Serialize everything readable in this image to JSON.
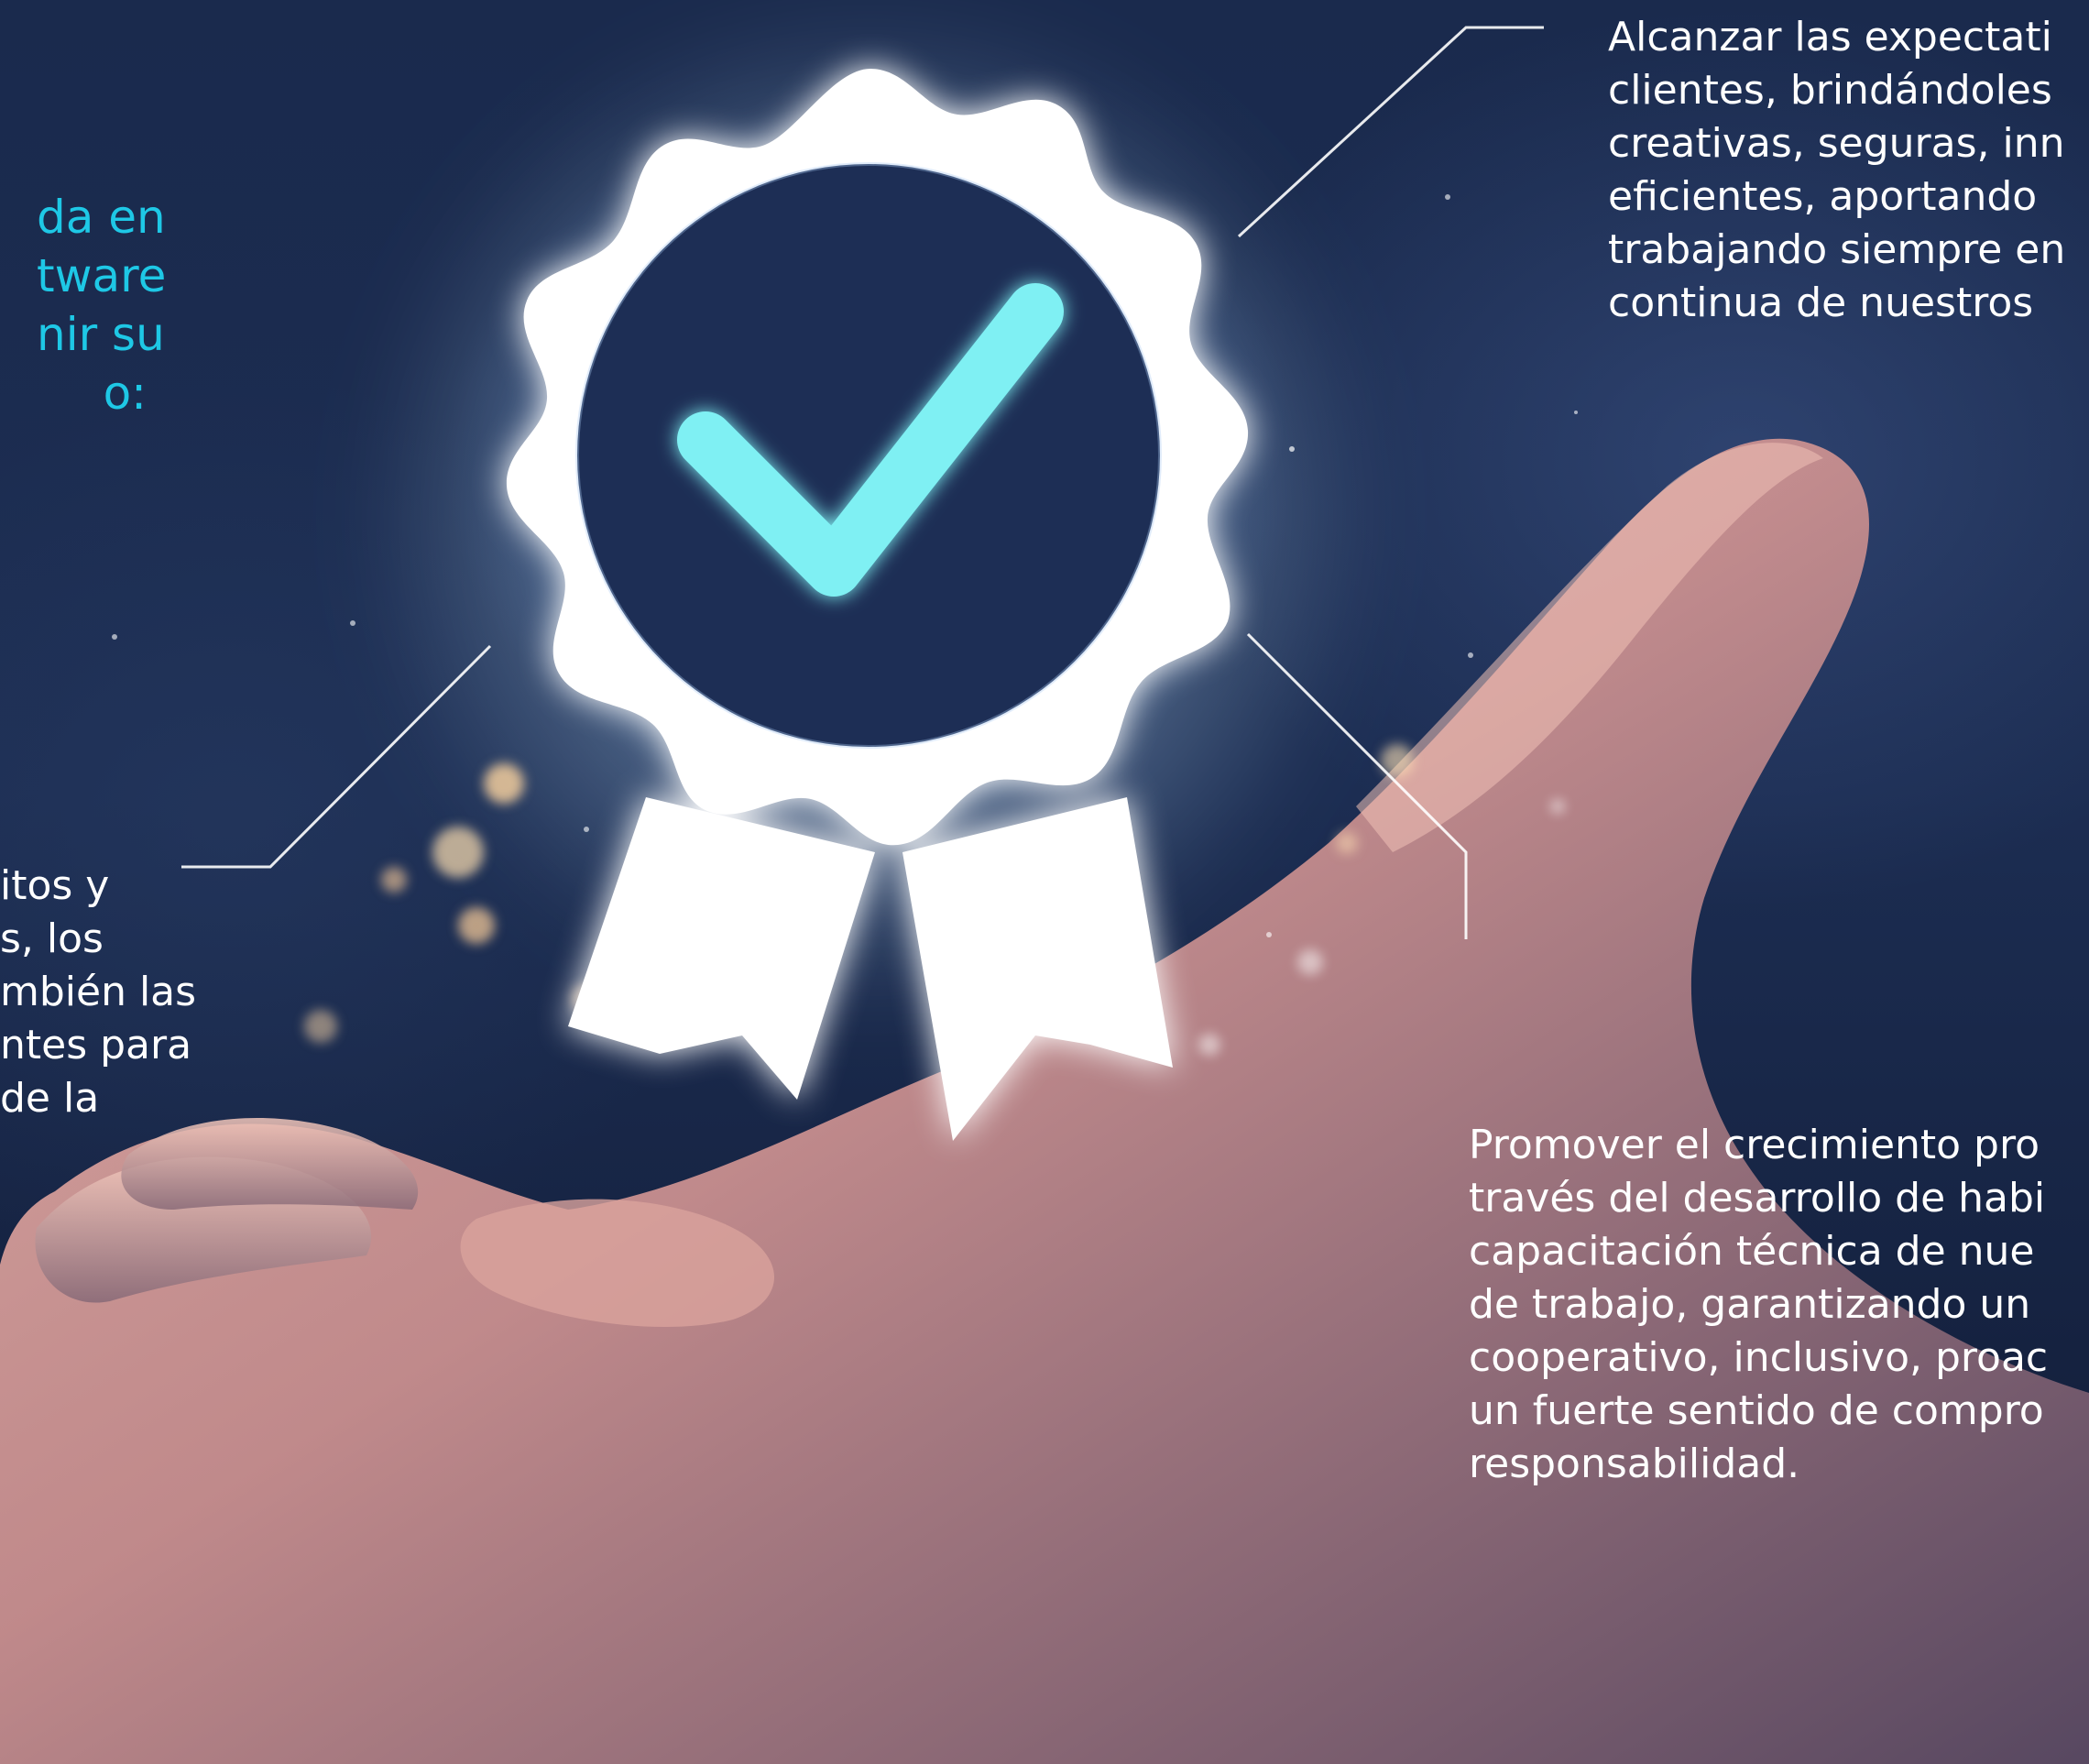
{
  "texts": {
    "left_heading": "da en\ntware\nnir su\no:",
    "left_body": "itos y\ns, los\nmbién las\nntes para\nde la",
    "top_right": "Alcanzar las expectati\nclientes, brindándoles\ncreativas, seguras, inn\neficientes, aportando\ntrabajando siempre en\ncontinua de nuestros",
    "bottom_right": "Promover el crecimiento pro\ntravés del desarrollo de habi\ncapacitación técnica de nue\nde trabajo, garantizando un\ncooperativo, inclusivo, proac\nun fuerte sentido de compro\nresponsabilidad."
  },
  "colors": {
    "heading": "#1ec8e6",
    "body": "#ffffff",
    "check": "#7ff0f3",
    "badge": "#ffffff",
    "badge_center": "#1d2e55"
  },
  "icons": {
    "badge": "award-ribbon-icon",
    "check": "checkmark-icon",
    "hand": "open-hand-illustration"
  }
}
